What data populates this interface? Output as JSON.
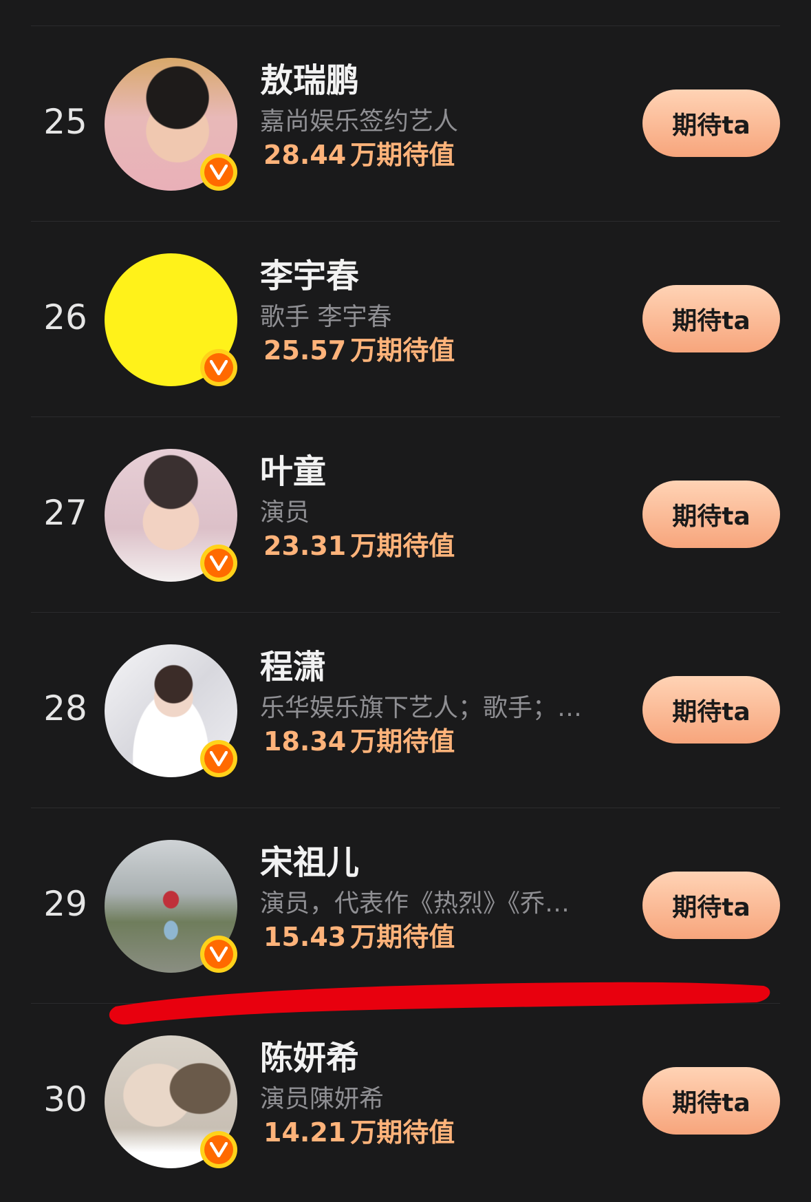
{
  "accent_color": "#ffb37a",
  "button_gradient": [
    "#ffd3b5",
    "#f7a57c"
  ],
  "badge_icon": "verified-v-icon",
  "rows": [
    {
      "rank": "25",
      "name": "敖瑞鹏",
      "desc": "嘉尚娱乐签约艺人",
      "score_num": "28.44",
      "score_unit": "万期待值",
      "button": "期待ta",
      "avatar_icon": "avatar-photo"
    },
    {
      "rank": "26",
      "name": "李宇春",
      "desc": "歌手 李宇春",
      "score_num": "25.57",
      "score_unit": "万期待值",
      "button": "期待ta",
      "avatar_icon": "avatar-yellow-circle"
    },
    {
      "rank": "27",
      "name": "叶童",
      "desc": "演员",
      "score_num": "23.31",
      "score_unit": "万期待值",
      "button": "期待ta",
      "avatar_icon": "avatar-photo"
    },
    {
      "rank": "28",
      "name": "程潇",
      "desc": "乐华娱乐旗下艺人；歌手；…",
      "score_num": "18.34",
      "score_unit": "万期待值",
      "button": "期待ta",
      "avatar_icon": "avatar-photo"
    },
    {
      "rank": "29",
      "name": "宋祖儿",
      "desc": "演员，代表作《热烈》《乔…",
      "score_num": "15.43",
      "score_unit": "万期待值",
      "button": "期待ta",
      "avatar_icon": "avatar-photo"
    },
    {
      "rank": "30",
      "name": "陈妍希",
      "desc": "演员陳妍希",
      "score_num": "14.21",
      "score_unit": "万期待值",
      "button": "期待ta",
      "avatar_icon": "avatar-photo"
    }
  ]
}
